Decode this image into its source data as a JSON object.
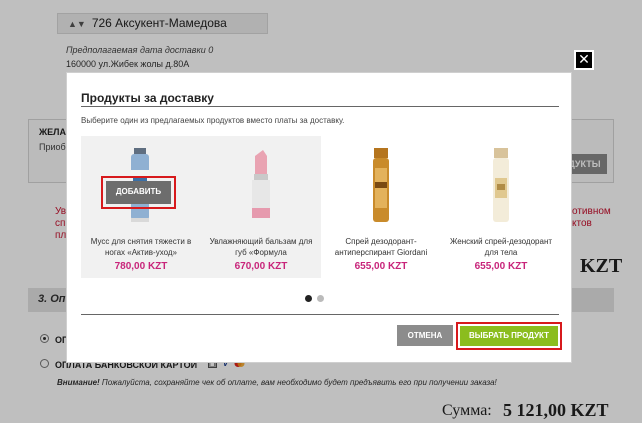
{
  "background": {
    "address_select_value": "726 Аксукент-Мамедова",
    "delivery_date_label": "Предполагаемая дата доставки 0",
    "address_line": "160000 ул.Жибек жолы д.80А",
    "wish_title": "ЖЕЛА",
    "wish_text": "Приоб",
    "products_button_partial": "ОДУКТЫ",
    "red_text_left": [
      "Ув",
      "сп",
      "пл"
    ],
    "red_text_right": [
      "отивном",
      "ктов"
    ],
    "kzt_partial": "KZT",
    "section_title": "3. Оп",
    "payment_cash_label": "ОП",
    "payment_card_label": "ОПЛАТА БАНКОВСКОЙ КАРТОЙ",
    "notice_bold": "Внимание!",
    "notice_text": " Пожалуйста, сохраняйте чек об оплате, вам необходимо будет предъявить его при получении заказа!",
    "total_label": "Сумма:",
    "total_value": "5 121,00 KZT"
  },
  "modal": {
    "title": "Продукты за доставку",
    "subtitle": "Выберите один из предлагаемых продуктов вместо платы за доставку.",
    "close_icon": "✕",
    "add_button_label": "ДОБАВИТЬ",
    "products": [
      {
        "name": "Мусс для снятия тяжести в ногах «Актив-уход»",
        "price": "780,00 KZT"
      },
      {
        "name": "Увлажняющий бальзам для губ «Формула",
        "price": "670,00 KZT"
      },
      {
        "name": "Спрей дезодорант-антиперспирант Giordani",
        "price": "655,00 KZT"
      },
      {
        "name": "Женский спрей-дезодорант для тела",
        "price": "655,00 KZT"
      }
    ],
    "cancel_label": "ОТМЕНА",
    "select_label": "ВЫБРАТЬ ПРОДУКТ"
  },
  "colors": {
    "price": "#c8247a",
    "select_button": "#8bbd1e",
    "highlight_frame": "#d7191c",
    "warning_text": "#c8102e"
  }
}
